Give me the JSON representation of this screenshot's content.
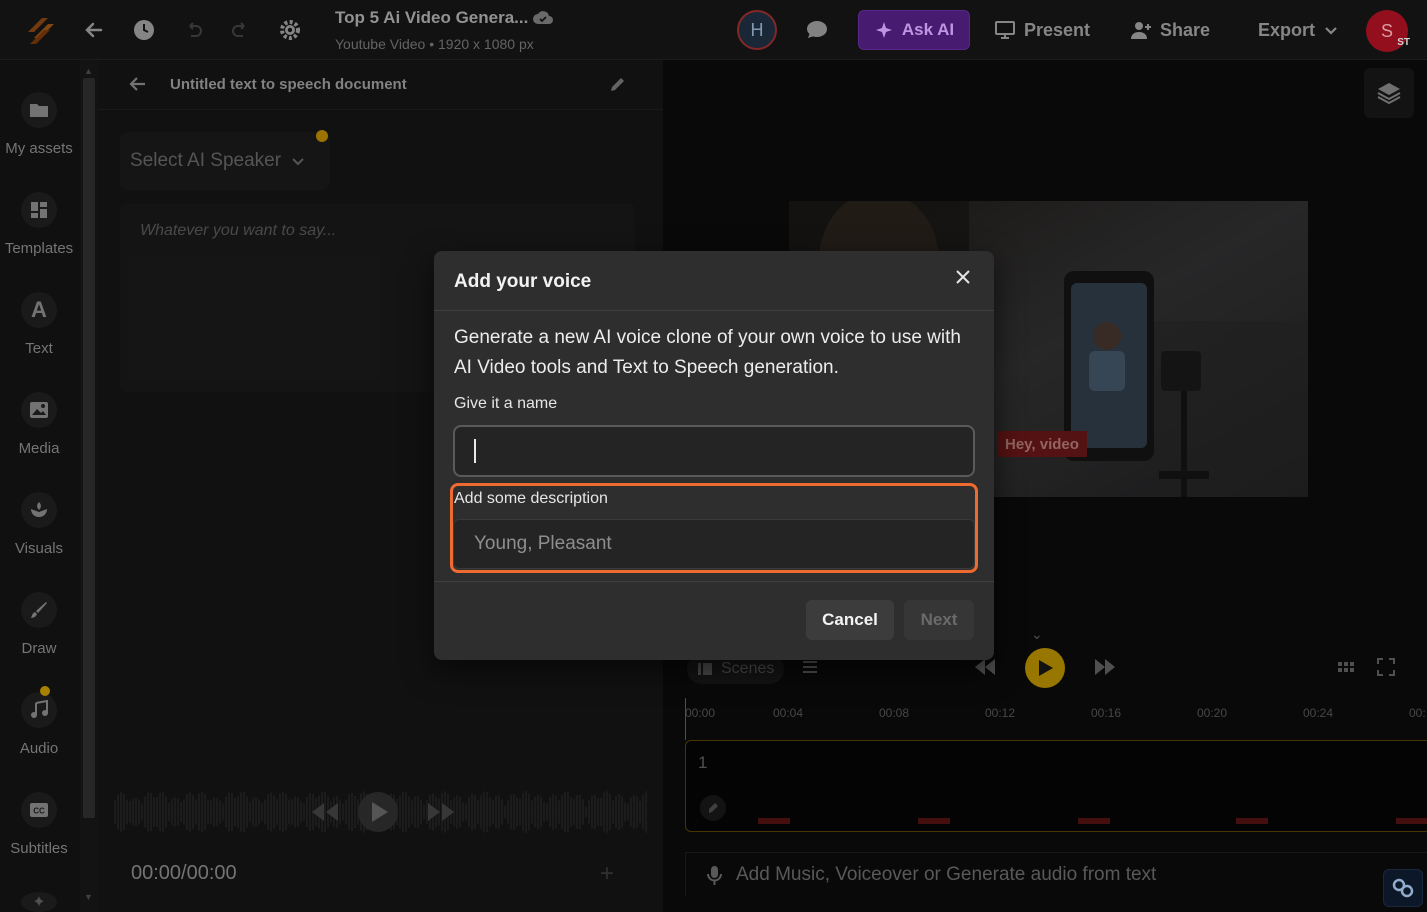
{
  "topbar": {
    "project_title": "Top 5 Ai Video Genera...",
    "project_subtitle": "Youtube Video • 1920 x 1080 px",
    "avatar_h": "H",
    "ask_ai_label": "Ask AI",
    "present_label": "Present",
    "share_label": "Share",
    "export_label": "Export",
    "avatar_s": "S",
    "avatar_s_badge": "ST"
  },
  "sidebar": {
    "items": [
      {
        "label": "My assets",
        "icon": "folder-icon"
      },
      {
        "label": "Templates",
        "icon": "templates-icon"
      },
      {
        "label": "Text",
        "icon": "text-icon"
      },
      {
        "label": "Media",
        "icon": "media-icon"
      },
      {
        "label": "Visuals",
        "icon": "visuals-icon"
      },
      {
        "label": "Draw",
        "icon": "draw-icon"
      },
      {
        "label": "Audio",
        "icon": "music-icon"
      },
      {
        "label": "Subtitles",
        "icon": "subtitles-icon"
      }
    ]
  },
  "tts": {
    "title": "Untitled text to speech document",
    "speaker_placeholder": "Select AI Speaker",
    "text_placeholder": "Whatever you want to say...",
    "time": "00:00/00:00"
  },
  "editor": {
    "preview_caption": "Hey, video",
    "scenes_label": "Scenes",
    "ticks": [
      "00:00",
      "00:04",
      "00:08",
      "00:12",
      "00:16",
      "00:20",
      "00:24",
      "00:"
    ],
    "scene_number": "1",
    "audio_prompt": "Add Music, Voiceover or Generate audio from text"
  },
  "modal": {
    "title": "Add your voice",
    "description": "Generate a new AI voice clone of your own voice to use with AI Video tools and Text to Speech generation.",
    "name_label": "Give it a name",
    "name_value": "",
    "desc_label": "Add some description",
    "desc_placeholder": "Young, Pleasant",
    "cancel_label": "Cancel",
    "next_label": "Next"
  },
  "colors": {
    "accent_orange": "#ee6a2f",
    "play_yellow": "#a17e00",
    "ask_ai_purple": "#4b1e76",
    "modal_bg": "#2e2e2e"
  }
}
